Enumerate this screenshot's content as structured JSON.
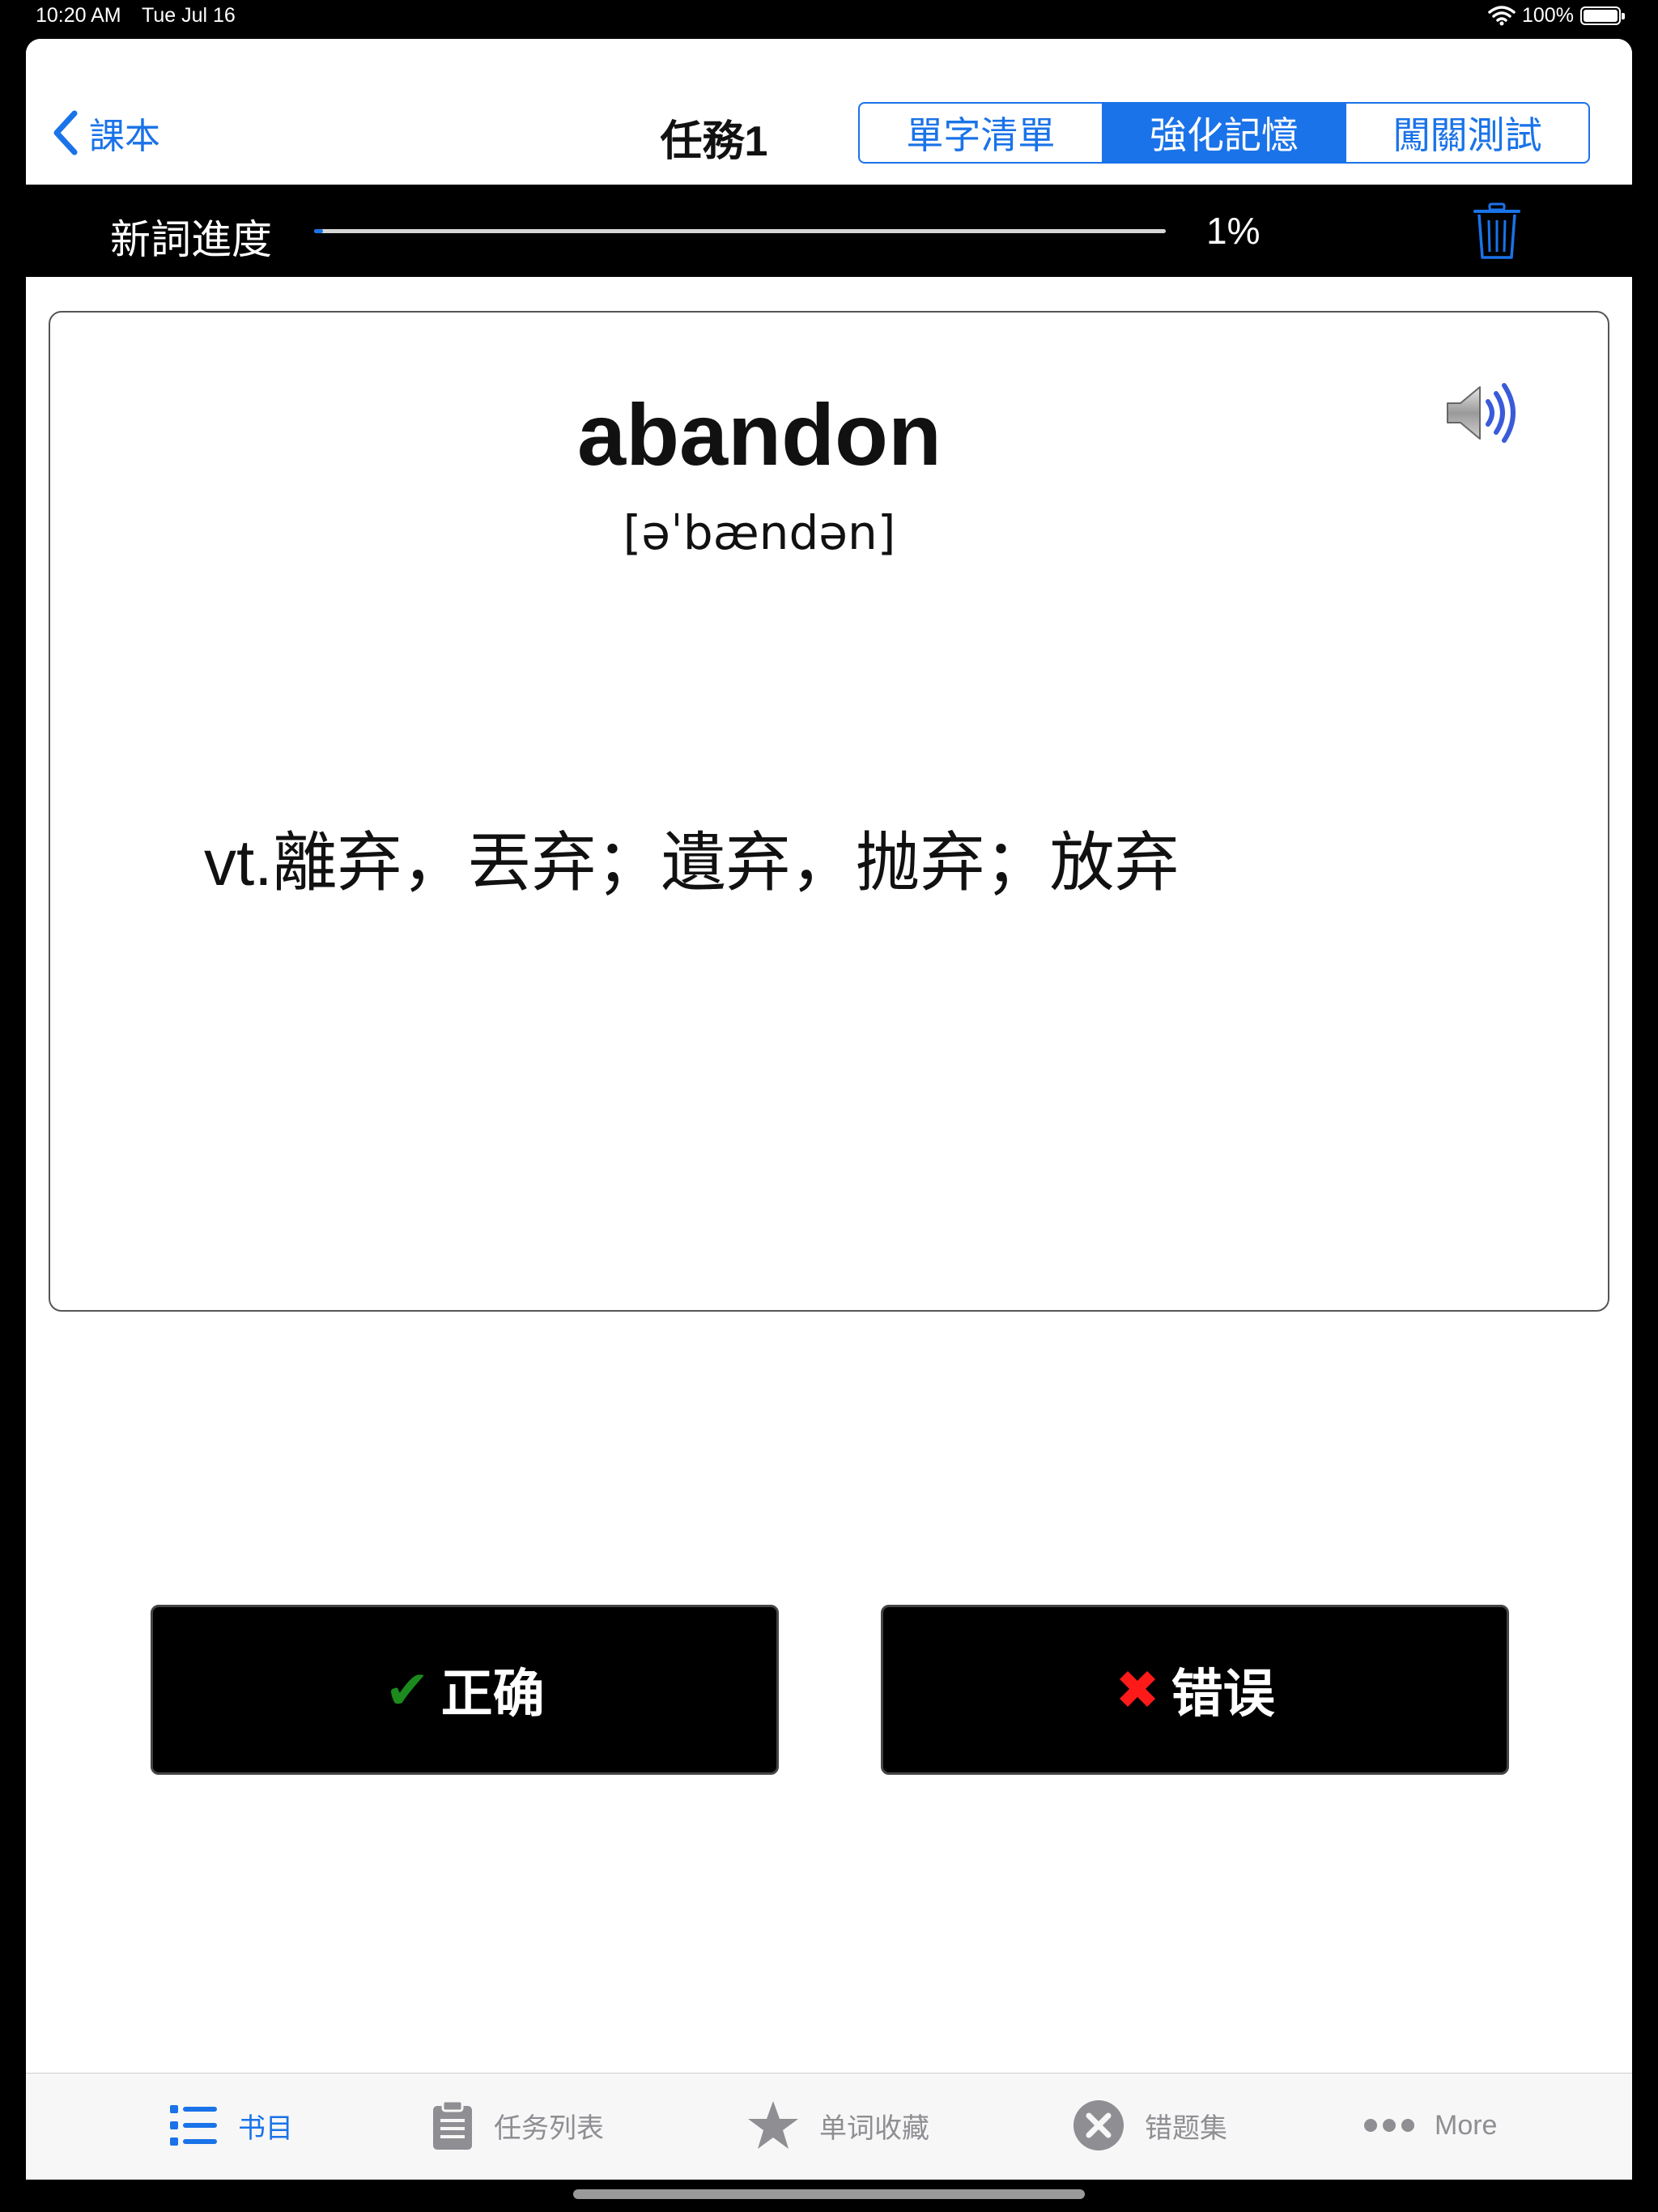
{
  "status_bar": {
    "time": "10:20 AM",
    "date": "Tue Jul 16",
    "battery": "100%"
  },
  "navbar": {
    "back_label": "課本",
    "title": "任務1",
    "segments": [
      "單字清單",
      "強化記憶",
      "闖關測試"
    ],
    "active_segment": 1
  },
  "progress": {
    "label": "新詞進度",
    "percent_text": "1%",
    "fraction": 0.01
  },
  "card": {
    "word": "abandon",
    "phonetic": "[əˈbændən]",
    "meaning": "vt.離弃，丟弃；遺弃，抛弃；放弃"
  },
  "buttons": {
    "correct_mark": "✔",
    "correct_label": "正确",
    "wrong_mark": "✖",
    "wrong_label": "错误"
  },
  "tabbar": {
    "items": [
      {
        "label": "书目",
        "icon": "list-icon"
      },
      {
        "label": "任务列表",
        "icon": "clipboard-icon"
      },
      {
        "label": "单词收藏",
        "icon": "star-icon"
      },
      {
        "label": "错题集",
        "icon": "x-circle-icon"
      },
      {
        "label": "More",
        "icon": "more-icon"
      }
    ],
    "active_index": 0
  },
  "colors": {
    "accent": "#1a73e8",
    "correct": "#1c8a1c",
    "wrong": "#ff1a1a",
    "inactive_tab": "#8e8e93"
  }
}
